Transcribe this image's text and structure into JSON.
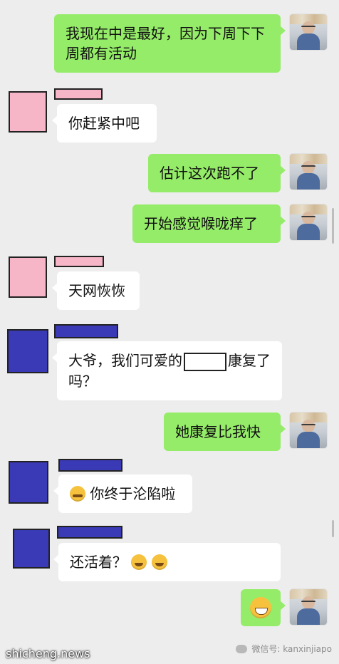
{
  "messages": [
    {
      "text": "我现在中是最好，因为下周下下周都有活动"
    },
    {
      "text": "你赶紧中吧"
    },
    {
      "text": "估计这次跑不了"
    },
    {
      "text": "开始感觉喉咙痒了"
    },
    {
      "text": "天网恢恢"
    },
    {
      "text_before": "大爷，我们可爱的",
      "text_after": "康复了吗？"
    },
    {
      "text": "她康复比我快"
    },
    {
      "text": "你终于沦陷啦",
      "emoji": "crying-laughing"
    },
    {
      "text": "还活着？",
      "emoji": "rofl"
    },
    {
      "text": "",
      "emoji": "grinning-big"
    }
  ],
  "watermarks": {
    "site": "shicheng.news",
    "wechat": "微信号: kanxinjiapo"
  },
  "colors": {
    "chat_background": "#ededed",
    "my_bubble": "#95ec69",
    "other_bubble": "#ffffff",
    "redaction_pink": "#f7b6c8",
    "redaction_blue": "#3a39b6"
  }
}
